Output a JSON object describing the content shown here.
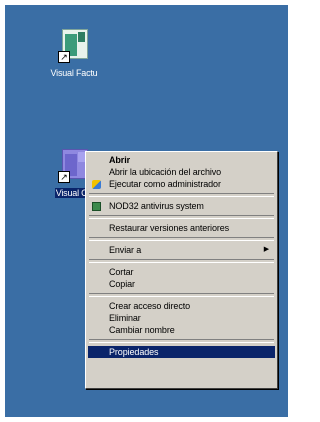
{
  "desktop": {
    "icons": [
      {
        "label": "Visual Factu"
      },
      {
        "label": "Visual Co"
      }
    ]
  },
  "context_menu": {
    "items": [
      {
        "label": "Abrir"
      },
      {
        "label": "Abrir la ubicación del archivo"
      },
      {
        "label": "Ejecutar como administrador"
      },
      {
        "label": "NOD32 antivirus system"
      },
      {
        "label": "Restaurar versiones anteriores"
      },
      {
        "label": "Enviar a"
      },
      {
        "label": "Cortar"
      },
      {
        "label": "Copiar"
      },
      {
        "label": "Crear acceso directo"
      },
      {
        "label": "Eliminar"
      },
      {
        "label": "Cambiar nombre"
      },
      {
        "label": "Propiedades"
      }
    ]
  },
  "colors": {
    "desktop_background": "#3a6ea5",
    "menu_background": "#d4d0c8",
    "selection": "#0a246a"
  }
}
